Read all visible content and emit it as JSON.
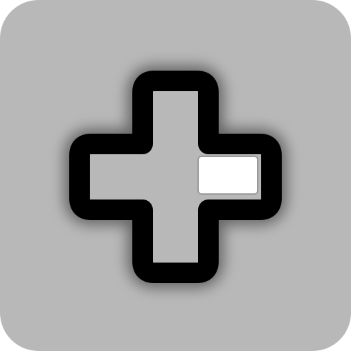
{
  "icon": {
    "name": "dpad-right-pressed-icon",
    "colors": {
      "tile_background": "#b8b8b8",
      "outline": "#000000",
      "dpad_fill": "#b8b8b8",
      "pressed_highlight": "#ffffff",
      "highlight_stroke": "#9a9a9a",
      "glow": "#000000"
    },
    "pressed_direction": "right"
  }
}
